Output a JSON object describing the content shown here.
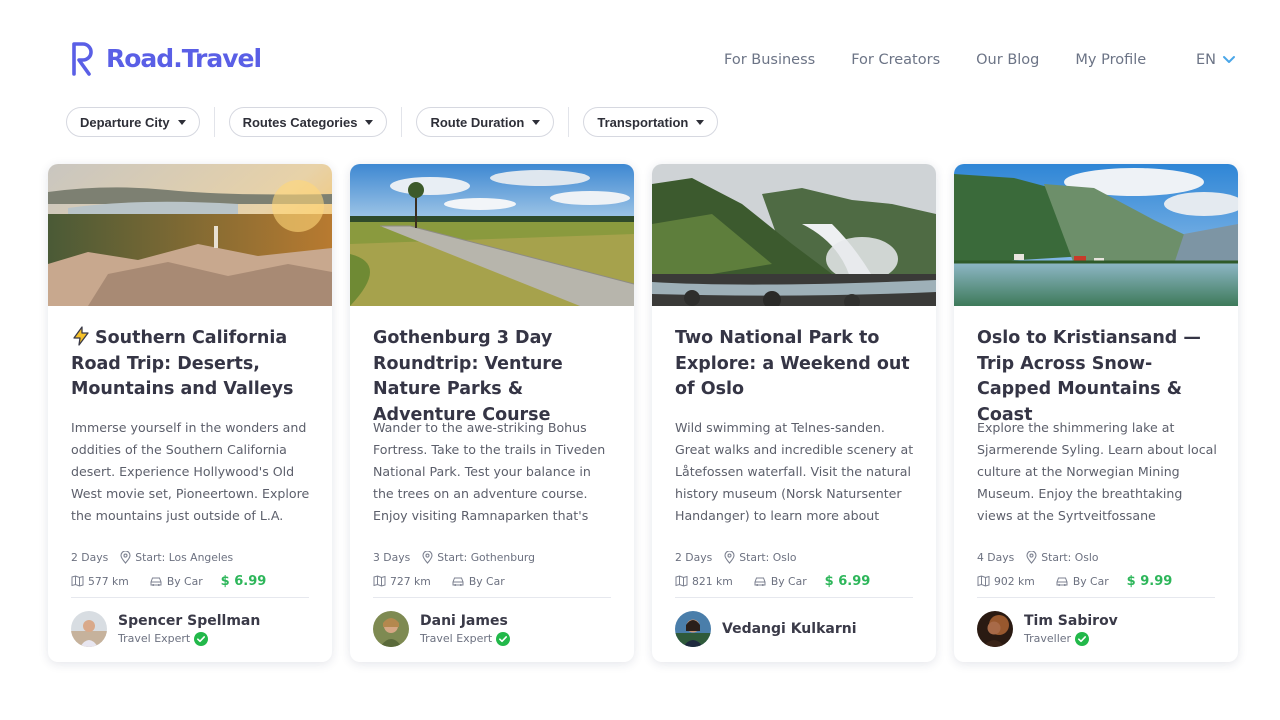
{
  "header": {
    "logo_text": "Road.Travel",
    "nav": [
      "For Business",
      "For Creators",
      "Our Blog",
      "My Profile"
    ],
    "lang": "EN"
  },
  "filters": [
    "Departure City",
    "Routes Categories",
    "Route Duration",
    "Transportation"
  ],
  "colors": {
    "brand": "#5a5fe6",
    "price": "#2db65a",
    "verified": "#22b84a"
  },
  "cards": [
    {
      "title": "Southern California Road Trip: Deserts, Mountains and Valleys",
      "has_bolt_icon": true,
      "description": "Immerse yourself in the wonders and oddities of the Southern California desert. Experience Hollywood's Old West movie set, Pioneertown. Explore the mountains just outside of L.A.",
      "duration": "2 Days",
      "start": "Start: Los Angeles",
      "distance": "577 km",
      "transport": "By Car",
      "price": "$ 6.99",
      "author": {
        "name": "Spencer Spellman",
        "role": "Travel Expert",
        "verified": true
      }
    },
    {
      "title": "Gothenburg 3 Day Roundtrip: Venture Nature Parks & Adventure Course",
      "has_bolt_icon": false,
      "description": "Wander to the awe-striking Bohus Fortress. Take to the trails in Tiveden National Park. Test your balance in the trees on an adventure course. Enjoy visiting Ramnaparken that's filled with…",
      "duration": "3 Days",
      "start": "Start: Gothenburg",
      "distance": "727 km",
      "transport": "By Car",
      "price": "",
      "author": {
        "name": "Dani James",
        "role": "Travel Expert",
        "verified": true
      }
    },
    {
      "title": "Two National Park to Explore: a Weekend out of Oslo",
      "has_bolt_icon": false,
      "description": "Wild swimming at Telnes-sanden. Great walks and incredible scenery at Låtefossen waterfall. Visit the natural history museum (Norsk Natursenter Handanger) to learn more about the…",
      "duration": "2 Days",
      "start": "Start: Oslo",
      "distance": "821 km",
      "transport": "By Car",
      "price": "$ 6.99",
      "author": {
        "name": "Vedangi Kulkarni",
        "role": "",
        "verified": false
      }
    },
    {
      "title": "Oslo to Kristiansand — Trip Across Snow-Capped Mountains & Coast",
      "has_bolt_icon": false,
      "description": "Explore the shimmering lake at Sjarmerende Syling. Learn about local culture at the Norwegian Mining Museum. Enjoy the breathtaking views at the Syrtveitfossane waterfall. Take…",
      "duration": "4 Days",
      "start": "Start: Oslo",
      "distance": "902 km",
      "transport": "By Car",
      "price": "$ 9.99",
      "author": {
        "name": "Tim Sabirov",
        "role": "Traveller",
        "verified": true
      }
    }
  ]
}
